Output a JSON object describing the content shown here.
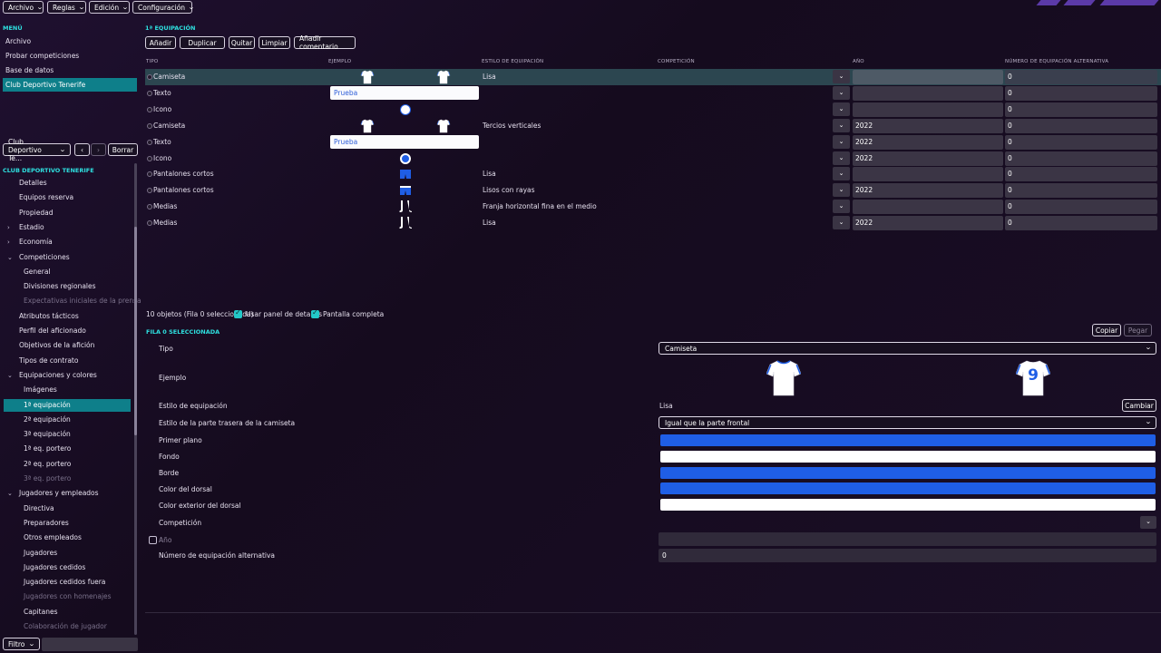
{
  "menubar": [
    {
      "label": "Archivo"
    },
    {
      "label": "Reglas"
    },
    {
      "label": "Edición"
    },
    {
      "label": "Configuración"
    }
  ],
  "sidebar": {
    "menu_title": "MENÚ",
    "menu_items": [
      "Archivo",
      "Probar competiciones",
      "Base de datos",
      "Club Deportivo Tenerife"
    ],
    "club_select": "Club Deportivo Te...",
    "borrar": "Borrar",
    "club_title": "CLUB DEPORTIVO TENERIFE",
    "tree": [
      {
        "label": "Detalles",
        "indent": 1
      },
      {
        "label": "Equipos reserva",
        "indent": 1
      },
      {
        "label": "Propiedad",
        "indent": 1
      },
      {
        "label": "Estadio",
        "indent": 1,
        "arrow": "›"
      },
      {
        "label": "Economía",
        "indent": 1,
        "arrow": "›"
      },
      {
        "label": "Competiciones",
        "indent": 1,
        "arrow": "⌄"
      },
      {
        "label": "General",
        "indent": 2
      },
      {
        "label": "Divisiones regionales",
        "indent": 2
      },
      {
        "label": "Expectativas iniciales de la prensa",
        "indent": 2,
        "dim": true
      },
      {
        "label": "Atributos tácticos",
        "indent": 1
      },
      {
        "label": "Perfil del aficionado",
        "indent": 1
      },
      {
        "label": "Objetivos de la afición",
        "indent": 1
      },
      {
        "label": "Tipos de contrato",
        "indent": 1
      },
      {
        "label": "Equipaciones y colores",
        "indent": 1,
        "arrow": "⌄"
      },
      {
        "label": "Imágenes",
        "indent": 2
      },
      {
        "label": "1ª equipación",
        "indent": 2,
        "selected": true
      },
      {
        "label": "2ª equipación",
        "indent": 2
      },
      {
        "label": "3ª equipación",
        "indent": 2
      },
      {
        "label": "1ª eq. portero",
        "indent": 2
      },
      {
        "label": "2ª eq. portero",
        "indent": 2
      },
      {
        "label": "3ª eq. portero",
        "indent": 2,
        "dim": true
      },
      {
        "label": "Jugadores y empleados",
        "indent": 1,
        "arrow": "⌄"
      },
      {
        "label": "Directiva",
        "indent": 2
      },
      {
        "label": "Preparadores",
        "indent": 2
      },
      {
        "label": "Otros empleados",
        "indent": 2
      },
      {
        "label": "Jugadores",
        "indent": 2
      },
      {
        "label": "Jugadores cedidos",
        "indent": 2
      },
      {
        "label": "Jugadores cedidos fuera",
        "indent": 2
      },
      {
        "label": "Jugadores con homenajes",
        "indent": 2,
        "dim": true
      },
      {
        "label": "Capitanes",
        "indent": 2
      },
      {
        "label": "Colaboración de jugador",
        "indent": 2,
        "dim": true
      }
    ],
    "filtro": "Filtro"
  },
  "main": {
    "title": "1ª EQUIPACIÓN",
    "toolbar": [
      "Añadir",
      "Duplicar",
      "Quitar",
      "Limpiar",
      "Añadir comentario"
    ],
    "columns": {
      "tipo": "TIPO",
      "ejemplo": "EJEMPLO",
      "estilo": "ESTILO DE EQUIPACIÓN",
      "competicion": "COMPETICIÓN",
      "anio": "AÑO",
      "alt": "NÚMERO DE EQUIPACIÓN ALTERNATIVA"
    },
    "rows": [
      {
        "tipo": "Camiseta",
        "example": "shirts",
        "estilo": "Lisa",
        "anio": "",
        "alt": "0",
        "selected": true
      },
      {
        "tipo": "Texto",
        "example": "text",
        "text_value": "Prueba",
        "estilo": "",
        "anio": "",
        "alt": "0"
      },
      {
        "tipo": "Icono",
        "example": "icon-white",
        "estilo": "",
        "anio": "",
        "alt": "0"
      },
      {
        "tipo": "Camiseta",
        "example": "shirts",
        "estilo": "Tercios verticales",
        "anio": "2022",
        "alt": "0"
      },
      {
        "tipo": "Texto",
        "example": "text",
        "text_value": "Prueba",
        "estilo": "",
        "anio": "2022",
        "alt": "0"
      },
      {
        "tipo": "Icono",
        "example": "icon-blue",
        "estilo": "",
        "anio": "2022",
        "alt": "0"
      },
      {
        "tipo": "Pantalones cortos",
        "example": "shorts",
        "estilo": "Lisa",
        "anio": "",
        "alt": "0"
      },
      {
        "tipo": "Pantalones cortos",
        "example": "shorts-stripe",
        "estilo": "Lisos con rayas",
        "anio": "2022",
        "alt": "0"
      },
      {
        "tipo": "Medias",
        "example": "socks",
        "estilo": "Franja horizontal fina en el medio",
        "anio": "",
        "alt": "0"
      },
      {
        "tipo": "Medias",
        "example": "socks",
        "estilo": "Lisa",
        "anio": "2022",
        "alt": "0"
      }
    ],
    "count_text": "10 objetos (Fila 0 seleccionada)",
    "usar_panel": "Usar panel de detalles",
    "pantalla_completa": "Pantalla completa",
    "copiar": "Copiar",
    "pegar": "Pegar",
    "detail_title": "FILA 0 SELECCIONADA",
    "detail": {
      "tipo_label": "Tipo",
      "tipo_value": "Camiseta",
      "ejemplo_label": "Ejemplo",
      "shirt_number": "9",
      "estilo_label": "Estilo de equipación",
      "estilo_value": "Lisa",
      "cambiar": "Cambiar",
      "trasera_label": "Estilo de la parte trasera de la camiseta",
      "trasera_value": "Igual que la parte frontal",
      "primer_plano": "Primer plano",
      "fondo": "Fondo",
      "borde": "Borde",
      "color_dorsal": "Color del dorsal",
      "color_ext_dorsal": "Color exterior del dorsal",
      "competicion": "Competición",
      "anio": "Año",
      "num_alt_label": "Número de equipación alternativa",
      "num_alt_value": "0"
    },
    "colors": {
      "primer_plano": "#1f5ee6",
      "fondo": "#ffffff",
      "borde": "#1f5ee6",
      "color_dorsal": "#1f5ee6",
      "color_ext_dorsal": "#ffffff"
    }
  }
}
